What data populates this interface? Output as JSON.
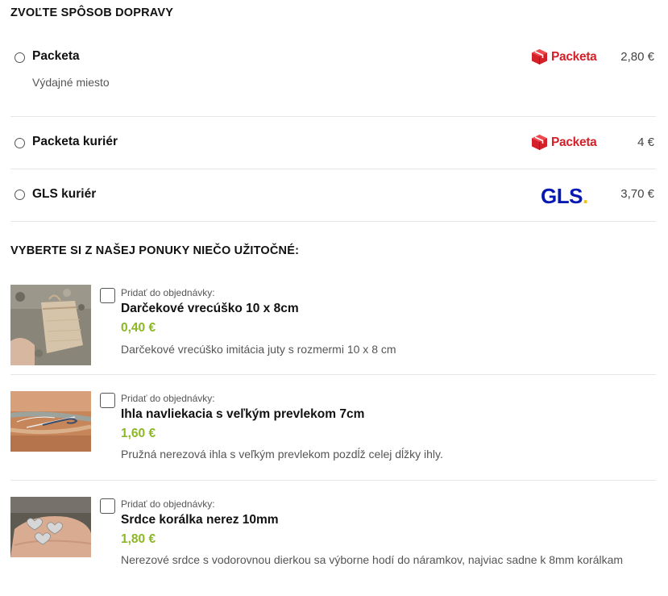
{
  "shipping": {
    "title": "ZVOĽTE SPÔSOB DOPRAVY",
    "options": [
      {
        "name": "Packeta",
        "subtitle": "Výdajné miesto",
        "logo": "Packeta",
        "price": "2,80 €"
      },
      {
        "name": "Packeta kuriér",
        "logo": "Packeta",
        "price": "4 €"
      },
      {
        "name": "GLS kuriér",
        "logo": "GLS",
        "price": "3,70 €"
      }
    ]
  },
  "addons": {
    "title": "VYBERTE SI Z NAŠEJ PONUKY NIEČO UŽITOČNÉ:",
    "items": [
      {
        "add_label": "Pridať do objednávky:",
        "name": "Darčekové vrecúško 10 x 8cm",
        "price": "0,40 €",
        "description": "Darčekové vrecúško imitácia juty s rozmermi 10 x 8 cm"
      },
      {
        "add_label": "Pridať do objednávky:",
        "name": "Ihla navliekacia s veľkým prevlekom 7cm",
        "price": "1,60 €",
        "description": "Pružná nerezová ihla s veľkým prevlekom pozdĺž celej dĺžky ihly."
      },
      {
        "add_label": "Pridať do objednávky:",
        "name": "Srdce korálka nerez 10mm",
        "price": "1,80 €",
        "description": "Nerezové srdce s vodorovnou dierkou sa výborne hodí do náramkov, najviac sadne k 8mm korálkam"
      }
    ]
  },
  "colors": {
    "price_green": "#8cb825",
    "packeta_red": "#d42028",
    "gls_blue": "#061ab1",
    "gls_yellow": "#f5c400"
  }
}
